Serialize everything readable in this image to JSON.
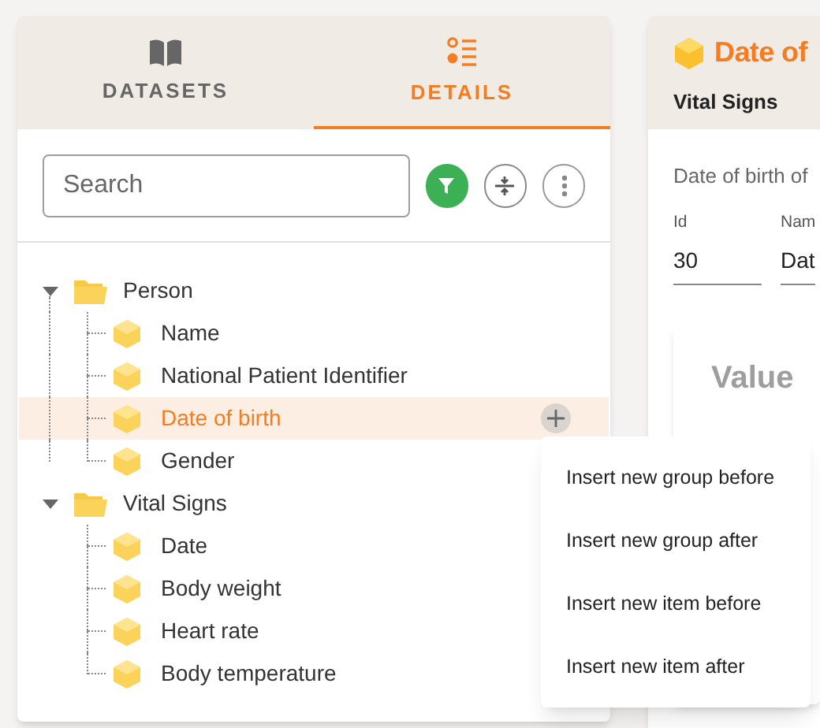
{
  "tabs": [
    {
      "label": "DATASETS",
      "kind": "book",
      "selected": false
    },
    {
      "label": "DETAILS",
      "kind": "list",
      "selected": true
    }
  ],
  "search": {
    "placeholder": "Search"
  },
  "tree": [
    {
      "label": "Person",
      "expanded": true,
      "selected": false,
      "children": [
        {
          "label": "Name",
          "selected": false
        },
        {
          "label": "National Patient Identifier",
          "selected": false
        },
        {
          "label": "Date of birth",
          "selected": true
        },
        {
          "label": "Gender",
          "selected": false
        }
      ]
    },
    {
      "label": "Vital Signs",
      "expanded": true,
      "selected": false,
      "children": [
        {
          "label": "Date",
          "selected": false
        },
        {
          "label": "Body weight",
          "selected": false
        },
        {
          "label": "Heart rate",
          "selected": false
        },
        {
          "label": "Body temperature",
          "selected": false
        }
      ]
    }
  ],
  "context_menu": [
    "Insert new group before",
    "Insert new group after",
    "Insert new item before",
    "Insert new item after"
  ],
  "detail": {
    "title": "Date of",
    "group": "Vital Signs",
    "description": "Date of birth of",
    "fields": [
      {
        "label": "Id",
        "value": "30"
      },
      {
        "label": "Nam",
        "value": "Dat"
      }
    ],
    "card_title": "Value"
  }
}
